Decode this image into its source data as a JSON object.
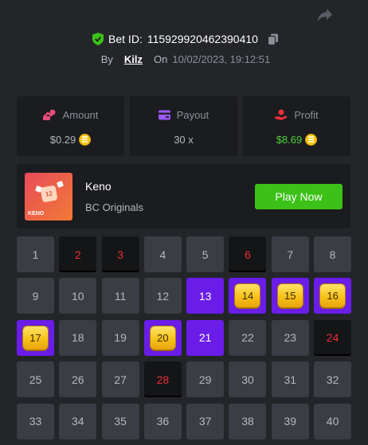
{
  "header": {
    "bet_label": "Bet ID:",
    "bet_id": "115929920462390410",
    "by_label": "By",
    "username": "Kilz",
    "on_label": "On",
    "date": "10/02/2023, 19:12:51"
  },
  "stats": {
    "amount_label": "Amount",
    "amount_value": "$0.29",
    "payout_label": "Payout",
    "payout_value": "30 x",
    "profit_label": "Profit",
    "profit_value": "$8.69"
  },
  "game": {
    "name": "Keno",
    "provider": "BC Originals",
    "play_label": "Play Now",
    "thumb_label": "KENO",
    "thumb_ball": "12"
  },
  "colors": {
    "background": "#232529",
    "card": "#1b1c1f",
    "cell": "#3a3d44",
    "miss_cell": "#141517",
    "miss_text": "#e8303a",
    "pick_cell": "#6a1de8",
    "play_button": "#3bc117",
    "profit_text": "#4cd137",
    "gold": "#f7c21a"
  },
  "board": {
    "cells": [
      {
        "n": "1",
        "state": "normal"
      },
      {
        "n": "2",
        "state": "miss"
      },
      {
        "n": "3",
        "state": "miss"
      },
      {
        "n": "4",
        "state": "normal"
      },
      {
        "n": "5",
        "state": "normal"
      },
      {
        "n": "6",
        "state": "miss"
      },
      {
        "n": "7",
        "state": "normal"
      },
      {
        "n": "8",
        "state": "normal"
      },
      {
        "n": "9",
        "state": "normal"
      },
      {
        "n": "10",
        "state": "normal"
      },
      {
        "n": "11",
        "state": "normal"
      },
      {
        "n": "12",
        "state": "normal"
      },
      {
        "n": "13",
        "state": "pick"
      },
      {
        "n": "14",
        "state": "hit"
      },
      {
        "n": "15",
        "state": "hit"
      },
      {
        "n": "16",
        "state": "hit"
      },
      {
        "n": "17",
        "state": "hit"
      },
      {
        "n": "18",
        "state": "normal"
      },
      {
        "n": "19",
        "state": "normal"
      },
      {
        "n": "20",
        "state": "hit"
      },
      {
        "n": "21",
        "state": "pick"
      },
      {
        "n": "22",
        "state": "normal"
      },
      {
        "n": "23",
        "state": "normal"
      },
      {
        "n": "24",
        "state": "miss"
      },
      {
        "n": "25",
        "state": "normal"
      },
      {
        "n": "26",
        "state": "normal"
      },
      {
        "n": "27",
        "state": "normal"
      },
      {
        "n": "28",
        "state": "miss"
      },
      {
        "n": "29",
        "state": "normal"
      },
      {
        "n": "30",
        "state": "normal"
      },
      {
        "n": "31",
        "state": "normal"
      },
      {
        "n": "32",
        "state": "normal"
      },
      {
        "n": "33",
        "state": "normal"
      },
      {
        "n": "34",
        "state": "normal"
      },
      {
        "n": "35",
        "state": "normal"
      },
      {
        "n": "36",
        "state": "normal"
      },
      {
        "n": "37",
        "state": "normal"
      },
      {
        "n": "38",
        "state": "normal"
      },
      {
        "n": "39",
        "state": "normal"
      },
      {
        "n": "40",
        "state": "normal"
      }
    ]
  }
}
